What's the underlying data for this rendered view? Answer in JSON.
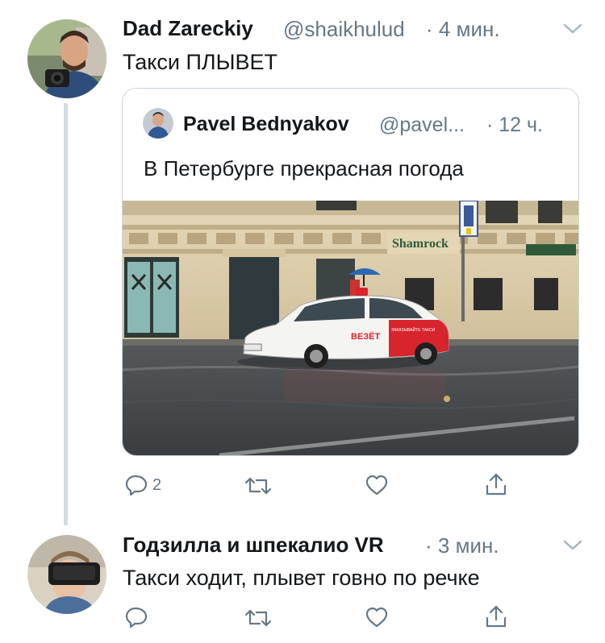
{
  "tweet1": {
    "name": "Dad Zareckiy",
    "handle": "@shaikhulud",
    "time": "· 4 мин.",
    "text": "Такси ПЛЫВЕТ",
    "avatar_icon": "man-with-camera-avatar",
    "quoted": {
      "name": "Pavel Bednyakov",
      "handle": "@pavel...",
      "time": "· 12 ч.",
      "text": "В Петербурге прекрасная погода",
      "media": {
        "sign_shamrock": "Shamrock",
        "car_logo": "ВЕЗЁТ",
        "car_door_text": "ЗАКАЗЫВАЙТЕ ТАКСИ"
      }
    },
    "actions": {
      "reply_count": "2",
      "retweet_count": "",
      "like_count": ""
    }
  },
  "tweet2": {
    "name": "Годзилла и шпекалио VR",
    "handle": "",
    "time": "· 3 мин.",
    "text": "Такси ходит, плывет говно по речке",
    "avatar_icon": "vr-headset-avatar",
    "actions": {
      "reply_count": "",
      "retweet_count": "",
      "like_count": ""
    }
  },
  "colors": {
    "text_primary": "#14171a",
    "text_secondary": "#657786",
    "border": "#ccd6dd",
    "thread_line": "#d0dae0",
    "taxi_red": "#d8242c"
  }
}
